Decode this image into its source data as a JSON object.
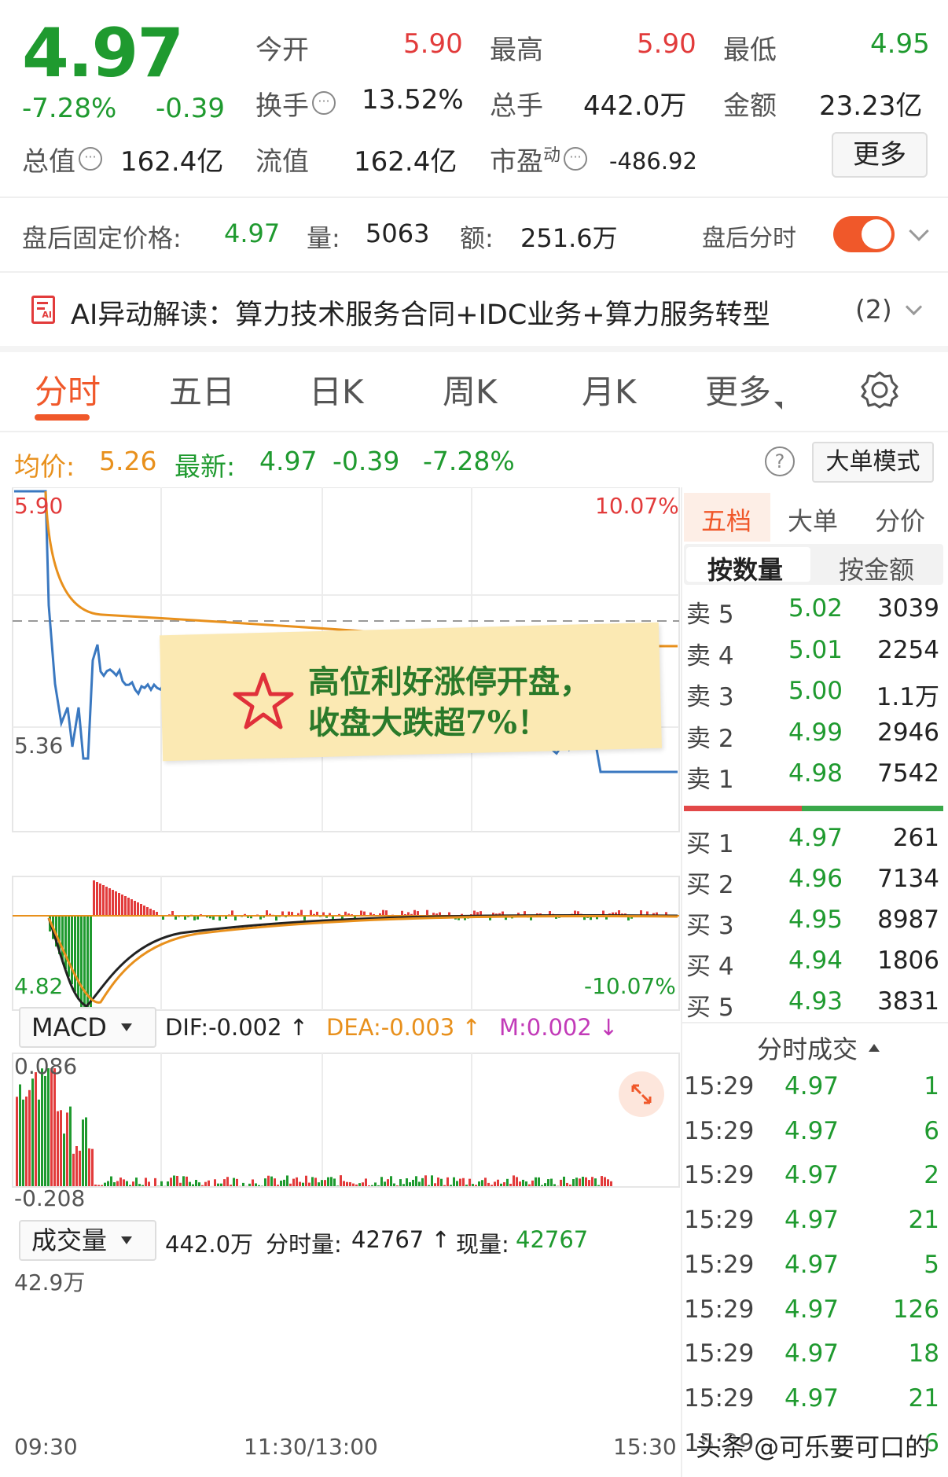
{
  "quote": {
    "price": "4.97",
    "change_pct": "-7.28%",
    "change": "-0.39",
    "open_label": "今开",
    "open": "5.90",
    "high_label": "最高",
    "high": "5.90",
    "low_label": "最低",
    "low": "4.95",
    "turnover_label": "换手",
    "turnover": "13.52%",
    "volume_label": "总手",
    "volume": "442.0万",
    "amount_label": "金额",
    "amount": "23.23亿",
    "mktcap_label": "总值",
    "mktcap": "162.4亿",
    "float_label": "流值",
    "float": "162.4亿",
    "pe_label": "市盈",
    "pe_sup": "动",
    "pe": "-486.92",
    "more_label": "更多"
  },
  "after_hours": {
    "price_label": "盘后固定价格:",
    "price": "4.97",
    "vol_label": "量:",
    "vol": "5063",
    "amt_label": "额:",
    "amt": "251.6万",
    "timeshare_label": "盘后分时"
  },
  "ai": {
    "text": "AI异动解读：算力技术服务合同+IDC业务+算力服务转型",
    "count": "(2)"
  },
  "tabs": [
    "分时",
    "五日",
    "日K",
    "周K",
    "月K",
    "更多"
  ],
  "intraday_info": {
    "avg_label": "均价:",
    "avg": "5.26",
    "latest_label": "最新:",
    "latest": "4.97",
    "change": "-0.39",
    "change_pct": "-7.28%",
    "big_order_label": "大单模式"
  },
  "price_axis": {
    "top": "5.90",
    "mid": "5.36",
    "bottom": "4.82",
    "top_pct": "10.07%",
    "bottom_pct": "-10.07%"
  },
  "macd": {
    "selector": "MACD",
    "dif": "DIF:-0.002 ↑",
    "dea": "DEA:-0.003 ↑",
    "m": "M:0.002 ↓",
    "top": "0.086",
    "bottom": "-0.208"
  },
  "volume_panel": {
    "selector": "成交量",
    "total": "442.0万",
    "tick_label": "分时量:",
    "tick": "42767 ↑",
    "now_label": "现量:",
    "now": "42767",
    "top": "42.9万"
  },
  "time_axis": [
    "09:30",
    "11:30/13:00",
    "15:30"
  ],
  "side": {
    "tabs": [
      "五档",
      "大单",
      "分价"
    ],
    "sub_tabs": [
      "按数量",
      "按金额"
    ],
    "asks": [
      {
        "label": "卖 5",
        "price": "5.02",
        "vol": "3039"
      },
      {
        "label": "卖 4",
        "price": "5.01",
        "vol": "2254"
      },
      {
        "label": "卖 3",
        "price": "5.00",
        "vol": "1.1万"
      },
      {
        "label": "卖 2",
        "price": "4.99",
        "vol": "2946"
      },
      {
        "label": "卖 1",
        "price": "4.98",
        "vol": "7542"
      }
    ],
    "bids": [
      {
        "label": "买 1",
        "price": "4.97",
        "vol": "261"
      },
      {
        "label": "买 2",
        "price": "4.96",
        "vol": "7134"
      },
      {
        "label": "买 3",
        "price": "4.95",
        "vol": "8987"
      },
      {
        "label": "买 4",
        "price": "4.94",
        "vol": "1806"
      },
      {
        "label": "买 5",
        "price": "4.93",
        "vol": "3831"
      }
    ],
    "trades_title": "分时成交",
    "trades": [
      {
        "time": "15:29",
        "price": "4.97",
        "vol": "1"
      },
      {
        "time": "15:29",
        "price": "4.97",
        "vol": "6"
      },
      {
        "time": "15:29",
        "price": "4.97",
        "vol": "2"
      },
      {
        "time": "15:29",
        "price": "4.97",
        "vol": "21"
      },
      {
        "time": "15:29",
        "price": "4.97",
        "vol": "5"
      },
      {
        "time": "15:29",
        "price": "4.97",
        "vol": "126"
      },
      {
        "time": "15:29",
        "price": "4.97",
        "vol": "18"
      },
      {
        "time": "15:29",
        "price": "4.97",
        "vol": "21"
      },
      {
        "time": "15:29",
        "price": "",
        "vol": "6"
      }
    ]
  },
  "note": {
    "line1": "高位利好涨停开盘，",
    "line2": "收盘大跌超7%！"
  },
  "watermark": "头条 @可乐要可口的",
  "colors": {
    "up": "#e23b3b",
    "down": "#1f9a2f",
    "avg": "#e8901c",
    "price_line": "#3a78c0",
    "accent": "#f0582a"
  }
}
